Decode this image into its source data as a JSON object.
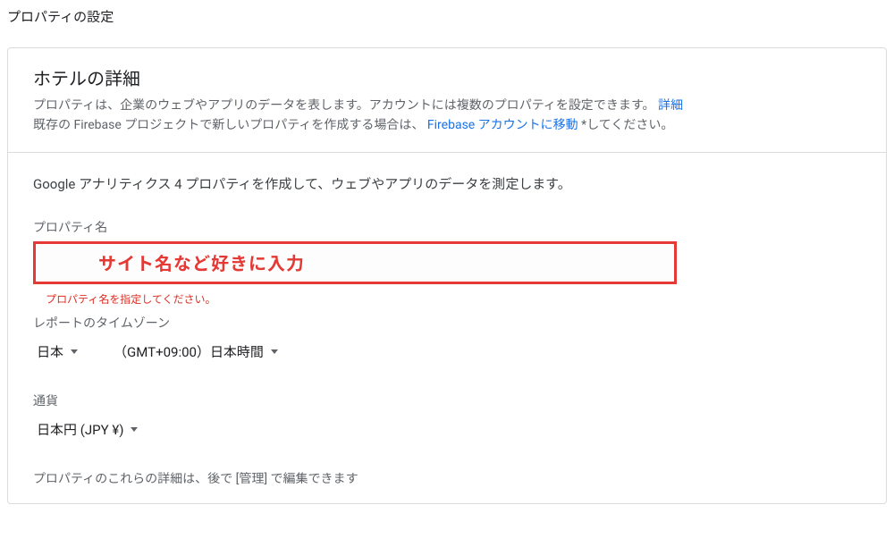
{
  "page": {
    "title": "プロパティの設定"
  },
  "header": {
    "title": "ホテルの詳細",
    "desc_part1": "プロパティは、企業のウェブやアプリのデータを表します。アカウントには複数のプロパティを設定できます。",
    "desc_link1": "詳細",
    "desc_part2": "既存の Firebase プロジェクトで新しいプロパティを作成する場合は、",
    "desc_link2": "Firebase アカウントに移動",
    "desc_part3": "*してください。"
  },
  "body": {
    "intro": "Google アナリティクス 4 プロパティを作成して、ウェブやアプリのデータを測定します。",
    "property_name_label": "プロパティ名",
    "annotation": "サイト名など好きに入力",
    "error": "プロパティ名を指定してください。",
    "timezone_label": "レポートのタイムゾーン",
    "timezone_country": "日本",
    "timezone_value": "（GMT+09:00）日本時間",
    "currency_label": "通貨",
    "currency_value": "日本円 (JPY ¥)",
    "footer_note": "プロパティのこれらの詳細は、後で [管理] で編集できます"
  }
}
